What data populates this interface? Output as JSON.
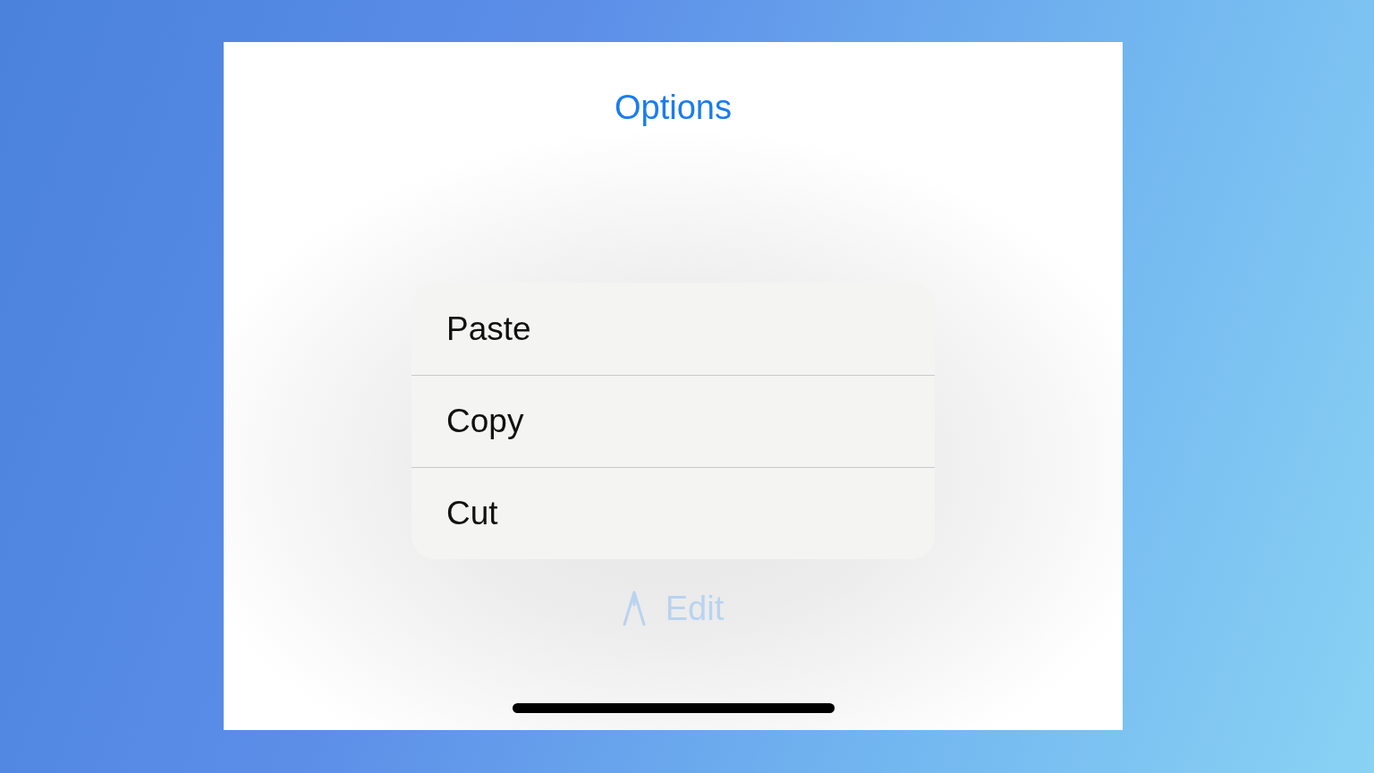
{
  "title": "Options",
  "menu": [
    {
      "label": "Paste"
    },
    {
      "label": "Copy"
    },
    {
      "label": "Cut"
    }
  ],
  "edit_button": {
    "label": "Edit",
    "disabled": true
  }
}
